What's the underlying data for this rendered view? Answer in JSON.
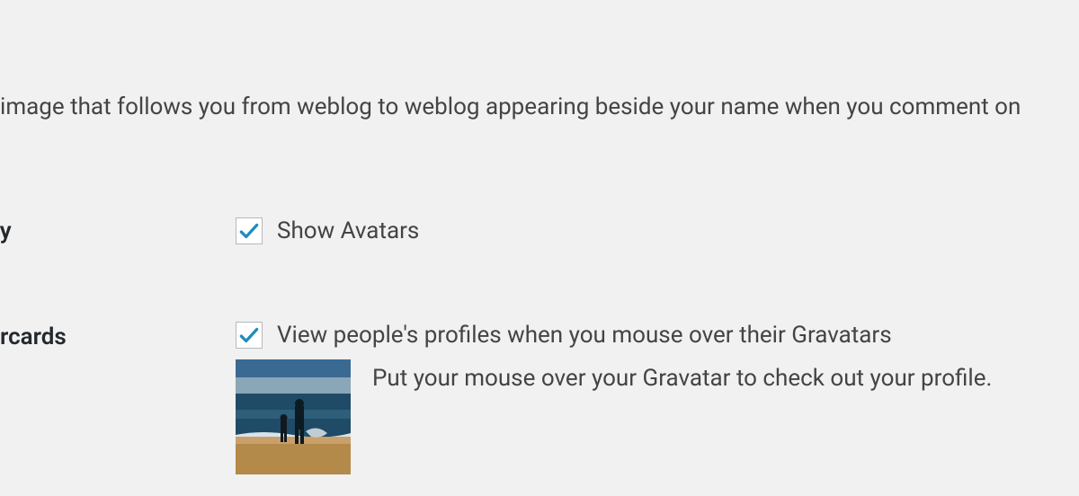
{
  "intro": {
    "text": " image that follows you from weblog to weblog appearing beside your name when you comment on "
  },
  "rows": {
    "avatar_display": {
      "label": "ay",
      "checkbox_label": "Show Avatars",
      "checked": true
    },
    "hovercards": {
      "label": "ercards",
      "checkbox_label": "View people's profiles when you mouse over their Gravatars",
      "checked": true,
      "description": "Put your mouse over your Gravatar to check out your profile."
    }
  }
}
